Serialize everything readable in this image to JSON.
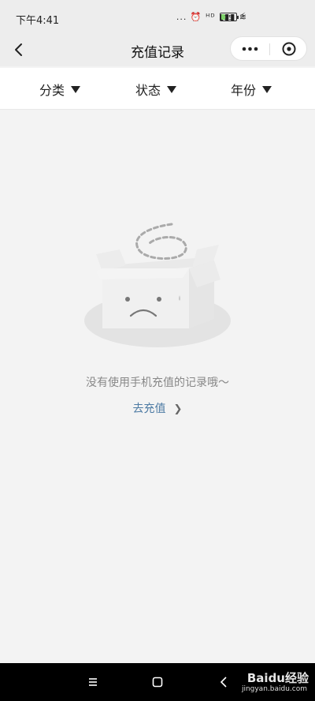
{
  "status_bar": {
    "time": "下午4:41",
    "icons": "... ⏰ ᴴᴰ ▮▮▮ ≋",
    "battery_level": "25",
    "battery_fill_fraction": 0.25
  },
  "nav": {
    "title": "充值记录"
  },
  "filters": [
    {
      "label": "分类"
    },
    {
      "label": "状态"
    },
    {
      "label": "年份"
    }
  ],
  "empty_state": {
    "message": "没有使用手机充值的记录哦～",
    "action_label": "去充值"
  },
  "footer": {
    "watermark": "Baidu经验",
    "watermark_url": "jingyan.baidu.com"
  },
  "colors": {
    "link": "#4c7aa3",
    "background": "#f3f3f3",
    "bar": "#ededed"
  }
}
